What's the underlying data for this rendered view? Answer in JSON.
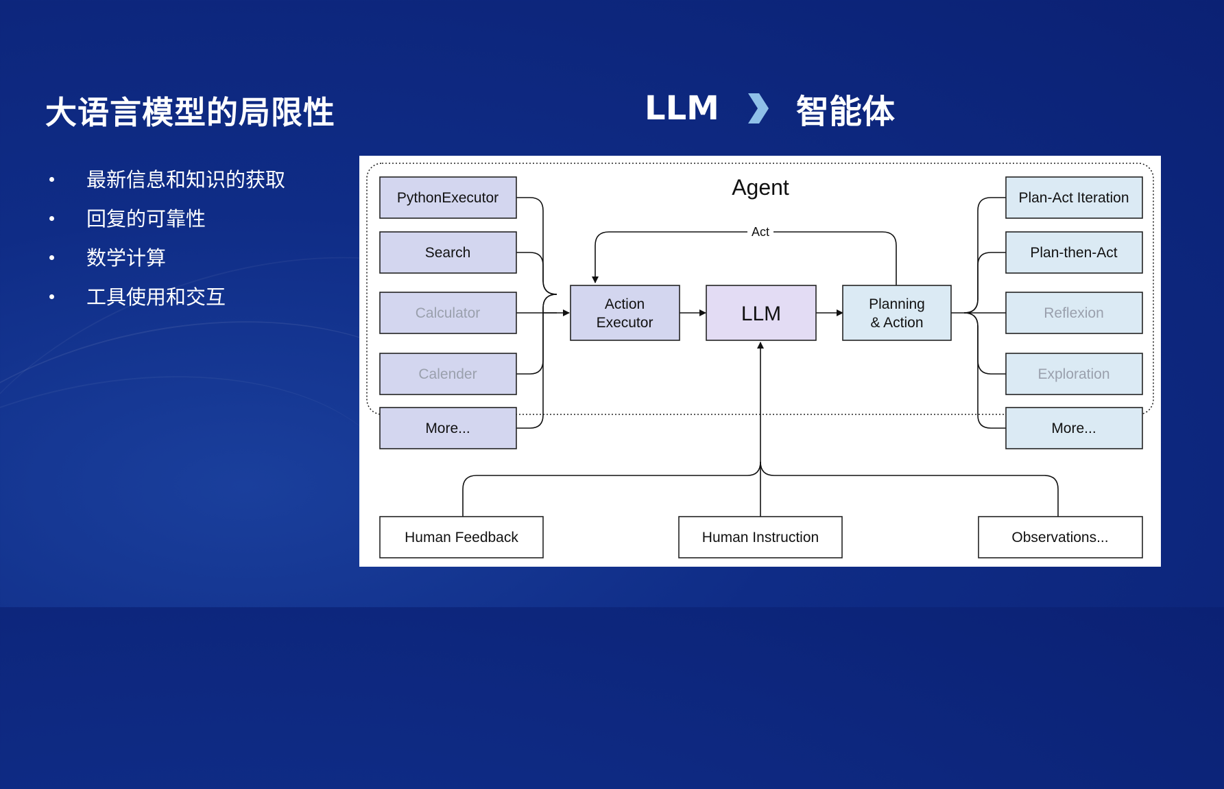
{
  "slide": {
    "title": "大语言模型的局限性",
    "bullets": [
      "最新信息和知识的获取",
      "回复的可靠性",
      "数学计算",
      "工具使用和交互"
    ],
    "headline_left": "LLM",
    "headline_right": "智能体"
  },
  "diagram": {
    "agent_label": "Agent",
    "act_label": "Act",
    "tools": [
      {
        "label": "PythonExecutor",
        "muted": false
      },
      {
        "label": "Search",
        "muted": false
      },
      {
        "label": "Calculator",
        "muted": true
      },
      {
        "label": "Calender",
        "muted": true
      },
      {
        "label": "More...",
        "muted": false
      }
    ],
    "action_executor": [
      "Action",
      "Executor"
    ],
    "llm": "LLM",
    "planning": [
      "Planning",
      "& Action"
    ],
    "strategies": [
      {
        "label": "Plan-Act Iteration",
        "muted": false
      },
      {
        "label": "Plan-then-Act",
        "muted": false
      },
      {
        "label": "Reflexion",
        "muted": true
      },
      {
        "label": "Exploration",
        "muted": true
      },
      {
        "label": "More...",
        "muted": false
      }
    ],
    "inputs": [
      "Human Feedback",
      "Human Instruction",
      "Observations..."
    ]
  },
  "colors": {
    "background": "#0f2c86",
    "tool_fill": "#d3d6ef",
    "llm_fill": "#e3dcf4",
    "strategy_fill": "#dbeaf4",
    "chevron": "#8fc0e8"
  }
}
